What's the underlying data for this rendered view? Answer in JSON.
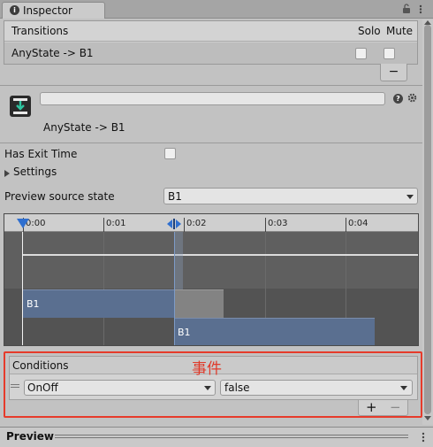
{
  "window": {
    "tab_label": "Inspector",
    "tab_icon": "info-icon"
  },
  "transitions": {
    "header": "Transitions",
    "col_solo": "Solo",
    "col_mute": "Mute",
    "row": "AnyState -> B1",
    "minus": "−"
  },
  "asset": {
    "name_field_value": "",
    "title": "AnyState -> B1"
  },
  "fields": {
    "has_exit_time_label": "Has Exit Time",
    "settings_label": "Settings",
    "preview_source_label": "Preview source state",
    "preview_source_value": "B1"
  },
  "timeline": {
    "ticks": [
      "0:00",
      "0:01",
      "0:02",
      "0:03",
      "0:04"
    ],
    "clip_a": "B1",
    "clip_b": "B1"
  },
  "conditions": {
    "header": "Conditions",
    "param": "OnOff",
    "value": "false",
    "plus": "+",
    "minus": "−"
  },
  "annotation": {
    "text": "事件",
    "color": "#e63b2b"
  },
  "footer": {
    "preview_label": "Preview"
  },
  "colors": {
    "clip": "#5a6f90",
    "marker": "#2f6fcf",
    "panel": "#c2c2c2"
  }
}
